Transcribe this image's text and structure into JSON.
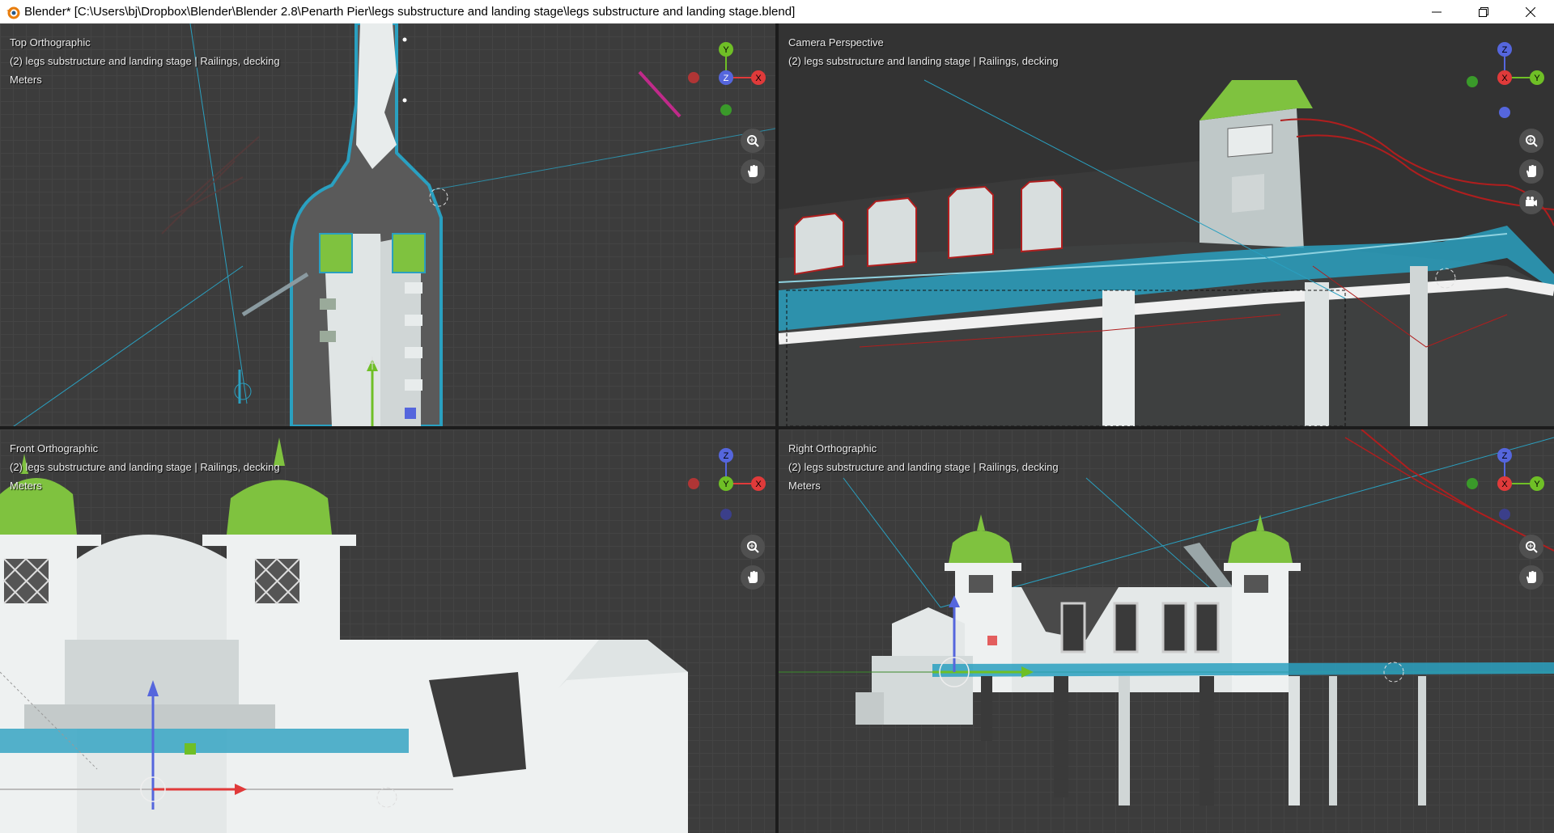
{
  "window": {
    "title": "Blender* [C:\\Users\\bj\\Dropbox\\Blender\\Blender 2.8\\Penarth Pier\\legs substructure and landing stage\\legs substructure and landing stage.blend]",
    "icon": "blender-logo-icon",
    "controls": [
      "minimize-icon",
      "restore-icon",
      "close-icon"
    ]
  },
  "colors": {
    "axis_x": "#e03a3a",
    "axis_y": "#6fbf26",
    "axis_z": "#5566dd",
    "selection": "#2aa0c0",
    "dome": "#7fc23f",
    "wire_red": "#b01e1e",
    "grid_bg": "#3c3c3c"
  },
  "viewports": [
    {
      "view_name": "Top Orthographic",
      "collection": "(2) legs substructure and landing stage | Railings, decking",
      "units": "Meters",
      "gizmo": {
        "top": "Y",
        "center": "Z",
        "right": "X"
      },
      "nav_icons": [
        "zoom-icon",
        "pan-hand-icon"
      ]
    },
    {
      "view_name": "Camera Perspective",
      "collection": "(2) legs substructure and landing stage | Railings, decking",
      "units": "",
      "gizmo": {
        "top": "Z",
        "center": "X",
        "right": "Y"
      },
      "nav_icons": [
        "zoom-icon",
        "pan-hand-icon",
        "camera-icon"
      ]
    },
    {
      "view_name": "Front Orthographic",
      "collection": "(2) legs substructure and landing stage | Railings, decking",
      "units": "Meters",
      "gizmo": {
        "top": "Z",
        "center": "Y",
        "right": "X"
      },
      "nav_icons": [
        "zoom-icon",
        "pan-hand-icon"
      ]
    },
    {
      "view_name": "Right Orthographic",
      "collection": "(2) legs substructure and landing stage | Railings, decking",
      "units": "Meters",
      "gizmo": {
        "top": "Z",
        "center": "X",
        "right": "Y"
      },
      "nav_icons": [
        "zoom-icon",
        "pan-hand-icon"
      ]
    }
  ]
}
